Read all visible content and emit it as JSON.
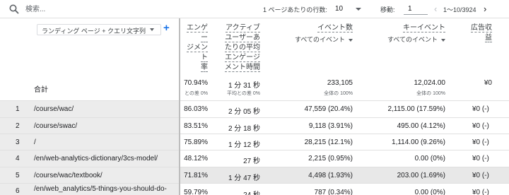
{
  "toolbar": {
    "search_placeholder": "検索...",
    "rows_per_page_label": "1 ページあたりの行数:",
    "rows_per_page_value": "10",
    "goto_label": "移動:",
    "goto_value": "1",
    "page_range": "1〜10/3924",
    "prev_icon": "chevron-left-icon",
    "next_icon": "chevron-right-icon"
  },
  "dimension": {
    "label": "ランディング ページ + クエリ文字列",
    "add_label": "+"
  },
  "columns": [
    {
      "title": [
        "エンゲー",
        "ジメント",
        "率"
      ],
      "sub": ""
    },
    {
      "title": [
        "アクティブ",
        "ユーザーあ",
        "たりの平均",
        "エンゲージ",
        "メント時間"
      ],
      "sub": ""
    },
    {
      "title": [
        "イベント数"
      ],
      "sub": "すべてのイベント"
    },
    {
      "title": [
        "キーイベント"
      ],
      "sub": "すべてのイベント"
    },
    {
      "title": [
        "広告収",
        "益"
      ],
      "sub": ""
    }
  ],
  "totals": {
    "label": "合計",
    "values": [
      "70.94%",
      "1 分 31 秒",
      "233,105",
      "12,024.00",
      "¥0"
    ],
    "subs": [
      "との差 0%",
      "平均との差 0%",
      "全体の 100%",
      "全体の 100%",
      ""
    ]
  },
  "rows": [
    {
      "index": "1",
      "path": "/course/wac/",
      "engagement_rate": "86.03%",
      "avg_time": "2 分 05 秒",
      "events": "47,559 (20.4%)",
      "key_events": "2,115.00 (17.59%)",
      "ad_revenue": "¥0 (-)"
    },
    {
      "index": "2",
      "path": "/course/swac/",
      "engagement_rate": "83.51%",
      "avg_time": "2 分 18 秒",
      "events": "9,118 (3.91%)",
      "key_events": "495.00 (4.12%)",
      "ad_revenue": "¥0 (-)"
    },
    {
      "index": "3",
      "path": "/",
      "engagement_rate": "75.89%",
      "avg_time": "1 分 12 秒",
      "events": "28,215 (12.1%)",
      "key_events": "1,114.00 (9.26%)",
      "ad_revenue": "¥0 (-)"
    },
    {
      "index": "4",
      "path": "/en/web-analytics-dictionary/3cs-model/",
      "engagement_rate": "48.12%",
      "avg_time": "27 秒",
      "events": "2,215 (0.95%)",
      "key_events": "0.00 (0%)",
      "ad_revenue": "¥0 (-)"
    },
    {
      "index": "5",
      "path": "/course/wac/textbook/",
      "engagement_rate": "71.81%",
      "avg_time": "1 分 47 秒",
      "events": "4,498 (1.93%)",
      "key_events": "203.00 (1.69%)",
      "ad_revenue": "¥0 (-)"
    },
    {
      "index": "6",
      "path": "/en/web_analytics/5-things-you-should-do-",
      "engagement_rate": "59.79%",
      "avg_time": "24 秒",
      "events": "787 (0.34%)",
      "key_events": "0.00 (0%)",
      "ad_revenue": "¥0 (-)"
    }
  ],
  "colors": {
    "accent": "#1a73e8",
    "highlight_row": "#e8e8e8",
    "dimension_shade": "#ececec"
  }
}
